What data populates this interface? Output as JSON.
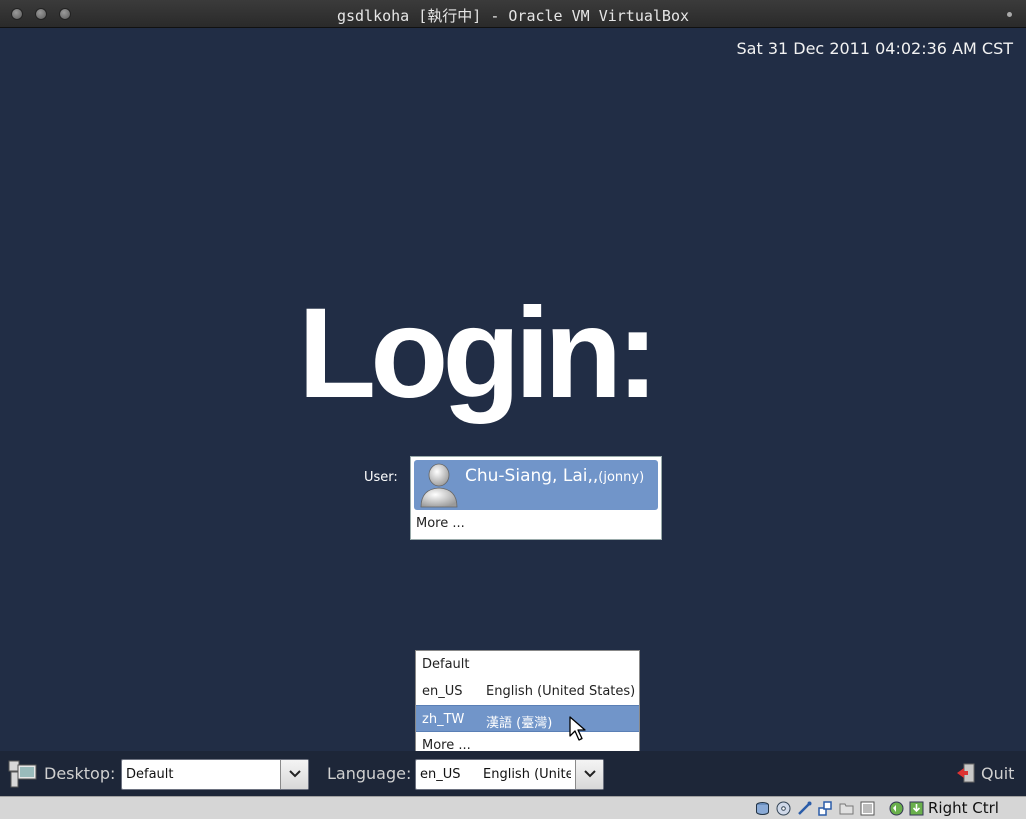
{
  "window": {
    "title": "gsdlkoha [執行中] - Oracle VM VirtualBox"
  },
  "screen": {
    "clock": "Sat 31 Dec 2011 04:02:36 AM CST",
    "login_title": "Login:",
    "user_label": "User:",
    "users": [
      {
        "name": "Chu-Siang, Lai,,",
        "username": "(jonny)",
        "selected": true
      }
    ],
    "user_more": "More ...",
    "language_options": [
      {
        "code": "Default",
        "name": ""
      },
      {
        "code": "en_US",
        "name": "English (United States)"
      },
      {
        "code": "zh_TW",
        "name": "漢語 (臺灣)",
        "highlighted": true
      },
      {
        "code": "More ...",
        "name": ""
      }
    ]
  },
  "panel": {
    "desktop_label": "Desktop:",
    "desktop_value": "Default",
    "language_label": "Language:",
    "language_code": "en_US",
    "language_name": "English (Unite",
    "quit_label": "Quit"
  },
  "statusbar": {
    "host_key": "Right Ctrl",
    "icons": [
      "hard-disk-icon",
      "optical-disk-icon",
      "usb-icon",
      "network-icon",
      "shared-folder-icon",
      "display-icon",
      "mouse-integration-icon",
      "keyboard-capture-icon"
    ]
  },
  "colors": {
    "screen_bg": "#212d45",
    "selection": "#7195c9",
    "panel_bg": "#1d2638"
  }
}
